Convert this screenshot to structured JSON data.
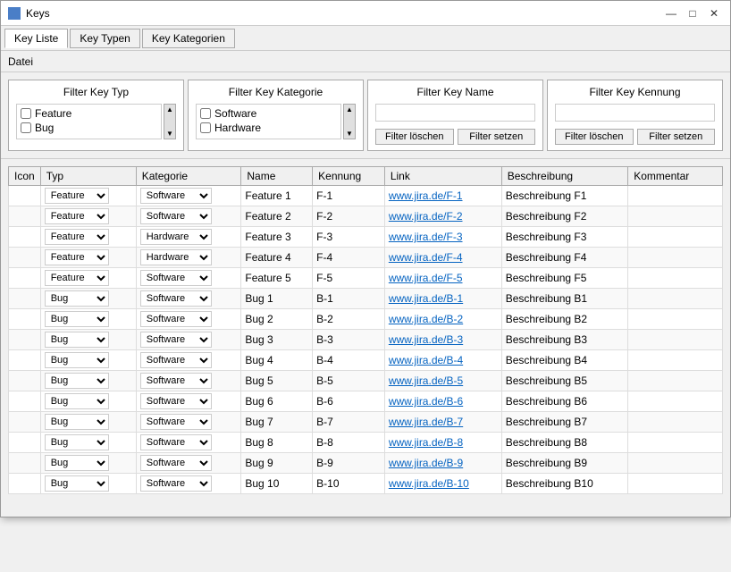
{
  "window": {
    "title": "Keys",
    "controls": {
      "minimize": "—",
      "maximize": "□",
      "close": "✕"
    }
  },
  "tabs": [
    {
      "label": "Key Liste",
      "active": true
    },
    {
      "label": "Key Typen",
      "active": false
    },
    {
      "label": "Key Kategorien",
      "active": false
    }
  ],
  "menu": {
    "datei": "Datei"
  },
  "filters": {
    "typ": {
      "title": "Filter Key Typ",
      "items": [
        {
          "label": "Feature",
          "checked": false
        },
        {
          "label": "Bug",
          "checked": false
        }
      ]
    },
    "kategorie": {
      "title": "Filter Key Kategorie",
      "items": [
        {
          "label": "Software",
          "checked": false
        },
        {
          "label": "Hardware",
          "checked": false
        }
      ]
    },
    "name": {
      "title": "Filter Key Name",
      "value": "",
      "placeholder": "",
      "btn_clear": "Filter löschen",
      "btn_set": "Filter setzen"
    },
    "kennung": {
      "title": "Filter Key Kennung",
      "value": "",
      "placeholder": "",
      "btn_clear": "Filter löschen",
      "btn_set": "Filter setzen"
    }
  },
  "table": {
    "headers": [
      "Icon",
      "Typ",
      "Kategorie",
      "Name",
      "Kennung",
      "Link",
      "Beschreibung",
      "Kommentar"
    ],
    "rows": [
      {
        "icon": "",
        "typ": "Feature",
        "kategorie": "Software",
        "name": "Feature 1",
        "kennung": "F-1",
        "link": "www.jira.de/F-1",
        "beschreibung": "Beschreibung F1",
        "kommentar": ""
      },
      {
        "icon": "",
        "typ": "Feature",
        "kategorie": "Software",
        "name": "Feature 2",
        "kennung": "F-2",
        "link": "www.jira.de/F-2",
        "beschreibung": "Beschreibung F2",
        "kommentar": ""
      },
      {
        "icon": "",
        "typ": "Feature",
        "kategorie": "Hardware",
        "name": "Feature 3",
        "kennung": "F-3",
        "link": "www.jira.de/F-3",
        "beschreibung": "Beschreibung F3",
        "kommentar": ""
      },
      {
        "icon": "",
        "typ": "Feature",
        "kategorie": "Hardware",
        "name": "Feature 4",
        "kennung": "F-4",
        "link": "www.jira.de/F-4",
        "beschreibung": "Beschreibung F4",
        "kommentar": ""
      },
      {
        "icon": "",
        "typ": "Feature",
        "kategorie": "Software",
        "name": "Feature 5",
        "kennung": "F-5",
        "link": "www.jira.de/F-5",
        "beschreibung": "Beschreibung F5",
        "kommentar": ""
      },
      {
        "icon": "",
        "typ": "Bug",
        "kategorie": "Software",
        "name": "Bug 1",
        "kennung": "B-1",
        "link": "www.jira.de/B-1",
        "beschreibung": "Beschreibung B1",
        "kommentar": ""
      },
      {
        "icon": "",
        "typ": "Bug",
        "kategorie": "Software",
        "name": "Bug 2",
        "kennung": "B-2",
        "link": "www.jira.de/B-2",
        "beschreibung": "Beschreibung B2",
        "kommentar": ""
      },
      {
        "icon": "",
        "typ": "Bug",
        "kategorie": "Software",
        "name": "Bug 3",
        "kennung": "B-3",
        "link": "www.jira.de/B-3",
        "beschreibung": "Beschreibung B3",
        "kommentar": ""
      },
      {
        "icon": "",
        "typ": "Bug",
        "kategorie": "Software",
        "name": "Bug 4",
        "kennung": "B-4",
        "link": "www.jira.de/B-4",
        "beschreibung": "Beschreibung B4",
        "kommentar": ""
      },
      {
        "icon": "",
        "typ": "Bug",
        "kategorie": "Software",
        "name": "Bug 5",
        "kennung": "B-5",
        "link": "www.jira.de/B-5",
        "beschreibung": "Beschreibung B5",
        "kommentar": ""
      },
      {
        "icon": "",
        "typ": "Bug",
        "kategorie": "Software",
        "name": "Bug 6",
        "kennung": "B-6",
        "link": "www.jira.de/B-6",
        "beschreibung": "Beschreibung B6",
        "kommentar": ""
      },
      {
        "icon": "",
        "typ": "Bug",
        "kategorie": "Software",
        "name": "Bug 7",
        "kennung": "B-7",
        "link": "www.jira.de/B-7",
        "beschreibung": "Beschreibung B7",
        "kommentar": ""
      },
      {
        "icon": "",
        "typ": "Bug",
        "kategorie": "Software",
        "name": "Bug 8",
        "kennung": "B-8",
        "link": "www.jira.de/B-8",
        "beschreibung": "Beschreibung B8",
        "kommentar": ""
      },
      {
        "icon": "",
        "typ": "Bug",
        "kategorie": "Software",
        "name": "Bug 9",
        "kennung": "B-9",
        "link": "www.jira.de/B-9",
        "beschreibung": "Beschreibung B9",
        "kommentar": ""
      },
      {
        "icon": "",
        "typ": "Bug",
        "kategorie": "Software",
        "name": "Bug 10",
        "kennung": "B-10",
        "link": "www.jira.de/B-10",
        "beschreibung": "Beschreibung B10",
        "kommentar": ""
      }
    ]
  }
}
